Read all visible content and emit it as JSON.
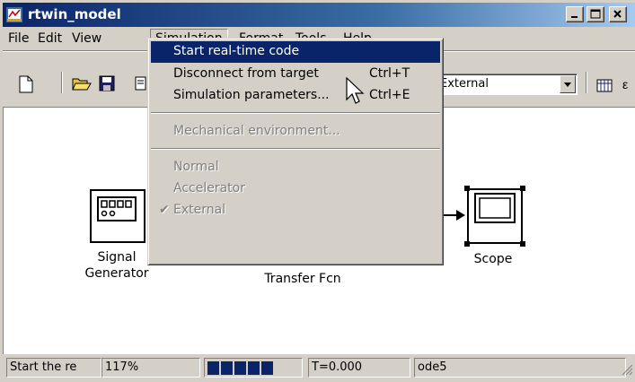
{
  "window": {
    "title": "rtwin_model"
  },
  "menubar": {
    "items": [
      "File",
      "Edit",
      "View",
      "Simulation",
      "Format",
      "Tools",
      "Help"
    ],
    "open_menu": "Simulation"
  },
  "toolbar": {
    "icons": [
      "new-icon",
      "open-icon",
      "save-icon",
      "print-icon",
      "library-browser-icon"
    ],
    "mode_select": {
      "value": "External"
    }
  },
  "simulation_menu": {
    "items": [
      {
        "label": "Start real-time code",
        "shortcut": "",
        "enabled": true,
        "highlighted": true,
        "checked": false
      },
      {
        "label": "Disconnect from target",
        "shortcut": "Ctrl+T",
        "enabled": true,
        "highlighted": false,
        "checked": false
      },
      {
        "label": "Simulation parameters...",
        "shortcut": "Ctrl+E",
        "enabled": true,
        "highlighted": false,
        "checked": false
      },
      {
        "label": "Mechanical environment...",
        "shortcut": "",
        "enabled": false,
        "highlighted": false,
        "checked": false
      },
      {
        "label": "Normal",
        "shortcut": "",
        "enabled": false,
        "highlighted": false,
        "checked": false
      },
      {
        "label": "Accelerator",
        "shortcut": "",
        "enabled": false,
        "highlighted": false,
        "checked": false
      },
      {
        "label": "External",
        "shortcut": "",
        "enabled": false,
        "highlighted": false,
        "checked": true
      }
    ]
  },
  "blocks": {
    "signal_generator": {
      "label_line1": "Signal",
      "label_line2": "Generator"
    },
    "transfer_fcn": {
      "label": "Transfer Fcn"
    },
    "scope": {
      "label": "Scope"
    }
  },
  "statusbar": {
    "message": "Start the re",
    "zoom": "117%",
    "progress_blocks": 5,
    "time": "T=0.000",
    "solver": "ode5"
  },
  "colors": {
    "titlebar_start": "#0a246a",
    "titlebar_end": "#a6caf0",
    "highlight": "#0a246a",
    "face": "#d4d0c8"
  }
}
